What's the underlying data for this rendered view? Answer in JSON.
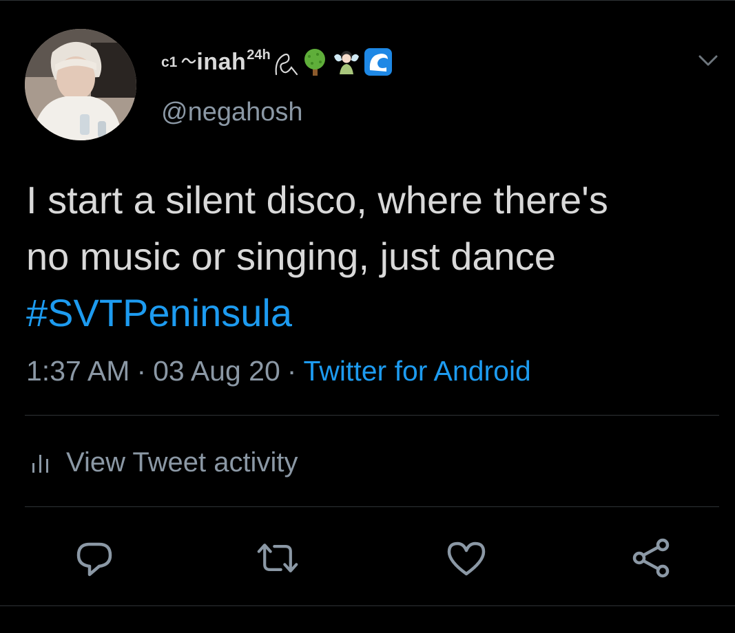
{
  "author": {
    "name_prefix": "c1",
    "name_main": "inah",
    "name_sup": "24h",
    "name_emojis": [
      "tree-icon",
      "fairy-icon",
      "wave-icon"
    ],
    "handle": "@negahosh",
    "avatar": "profile-photo"
  },
  "tweet": {
    "lines": [
      "I start a silent disco, where there's",
      "no music or singing, just dance"
    ],
    "hashtag": "#SVTPeninsula"
  },
  "meta": {
    "time": "1:37 AM",
    "separator": "·",
    "date": "03 Aug 20",
    "source": "Twitter for Android"
  },
  "activity": {
    "label": "View Tweet activity"
  },
  "actions": [
    "reply-icon",
    "retweet-icon",
    "like-icon",
    "share-icon"
  ],
  "colors": {
    "background": "#000000",
    "text": "#d9d9d9",
    "muted": "#8b98a5",
    "accent": "#1d9bf0",
    "divider": "#2f3336"
  }
}
